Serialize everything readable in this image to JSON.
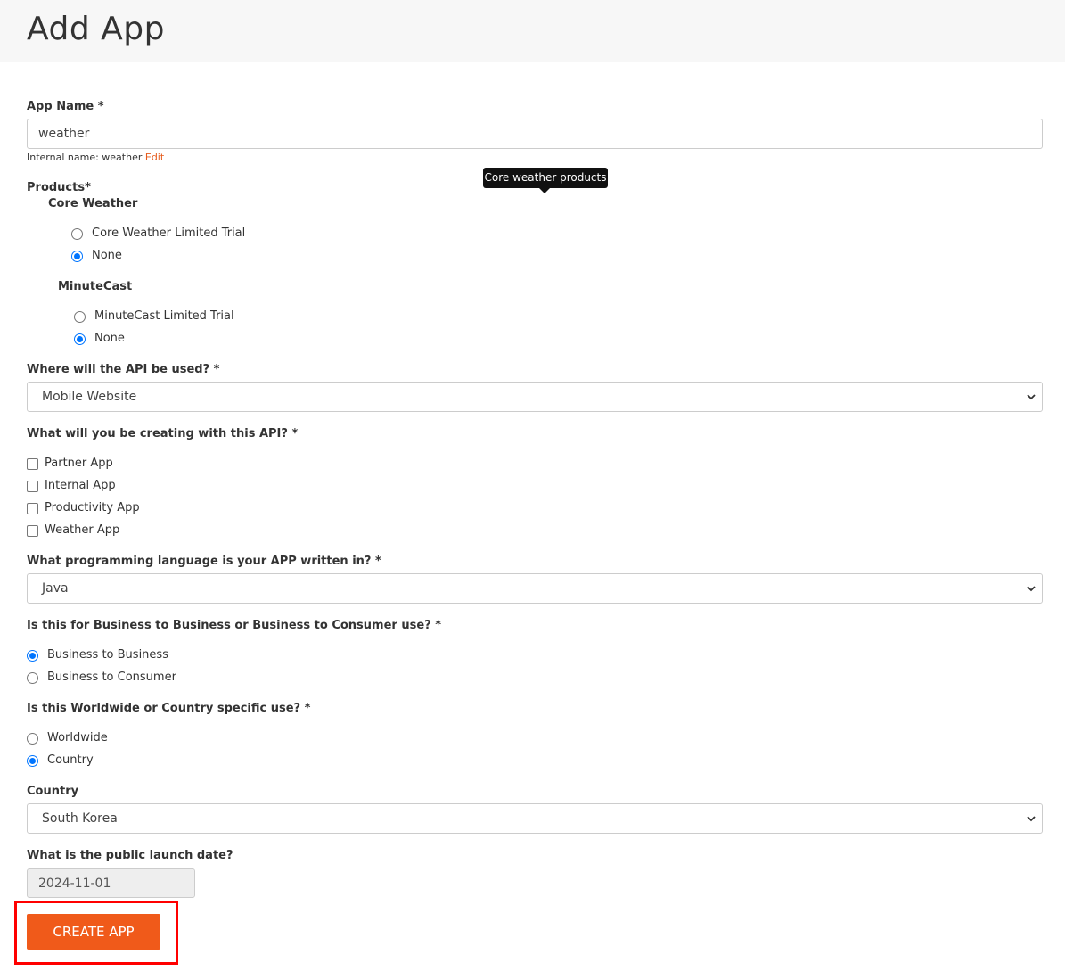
{
  "page": {
    "title": "Add App"
  },
  "app_name": {
    "label": "App Name *",
    "value": "weather",
    "hint_prefix": "Internal name: weather",
    "hint_edit": "Edit"
  },
  "products": {
    "label": "Products*",
    "tooltip": "Core weather products",
    "groups": [
      {
        "name": "Core Weather",
        "options": [
          {
            "label": "Core Weather Limited Trial",
            "checked": false
          },
          {
            "label": "None",
            "checked": true
          }
        ]
      },
      {
        "name": "MinuteCast",
        "options": [
          {
            "label": "MinuteCast Limited Trial",
            "checked": false
          },
          {
            "label": "None",
            "checked": true
          }
        ]
      }
    ]
  },
  "api_usage": {
    "label": "Where will the API be used? *",
    "selected": "Mobile Website"
  },
  "creating": {
    "label": "What will you be creating with this API? *",
    "options": [
      {
        "label": "Partner App",
        "checked": false
      },
      {
        "label": "Internal App",
        "checked": false
      },
      {
        "label": "Productivity App",
        "checked": false
      },
      {
        "label": "Weather App",
        "checked": false
      }
    ]
  },
  "language": {
    "label": "What programming language is your APP written in? *",
    "selected": "Java"
  },
  "business_type": {
    "label": "Is this for Business to Business or Business to Consumer use? *",
    "options": [
      {
        "label": "Business to Business",
        "checked": true
      },
      {
        "label": "Business to Consumer",
        "checked": false
      }
    ]
  },
  "scope": {
    "label": "Is this Worldwide or Country specific use? *",
    "options": [
      {
        "label": "Worldwide",
        "checked": false
      },
      {
        "label": "Country",
        "checked": true
      }
    ]
  },
  "country": {
    "label": "Country",
    "selected": "South Korea"
  },
  "launch_date": {
    "label": "What is the public launch date?",
    "value": "2024-11-01"
  },
  "submit": {
    "label": "CREATE APP"
  },
  "colors": {
    "accent": "#f05a1a",
    "link": "#e65b1c",
    "radio_checked": "#0075ff",
    "highlight": "#ff0000"
  }
}
